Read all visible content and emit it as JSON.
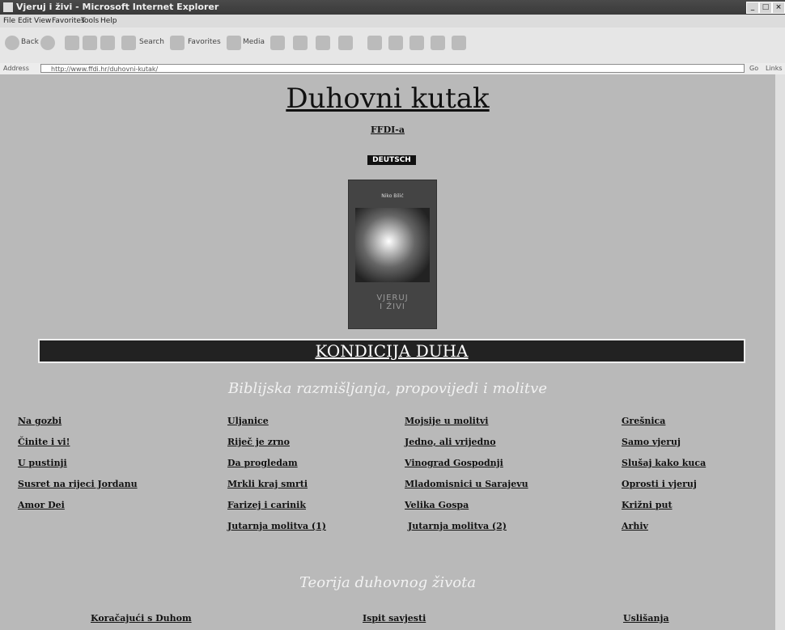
{
  "window": {
    "title": "Vjeruj i živi - Microsoft Internet Explorer"
  },
  "menu": [
    "File",
    "Edit",
    "View",
    "Favorites",
    "Tools",
    "Help"
  ],
  "toolbar": {
    "back": "Back",
    "search": "Search",
    "favorites": "Favorites",
    "media": "Media"
  },
  "address": {
    "label": "Address",
    "url": "http://www.ffdi.hr/duhovni-kutak/",
    "go": "Go",
    "links": "Links"
  },
  "page": {
    "title": "Duhovni kutak",
    "ffdi_link": "FFDI-a",
    "deutsch": "DEUTSCH",
    "book": {
      "author": "Niko Bilić",
      "title_line1": "VJERUJ",
      "title_line2": "I ŽIVI"
    },
    "banner": "KONDICIJA DUHA",
    "subtitle1": "Biblijska razmišljanja, propovijedi i molitve",
    "links_col1": [
      "Na gozbi",
      "Činite i vi!",
      "U pustinji",
      "Susret na rijeci Jordanu",
      "Amor Dei"
    ],
    "links_col2": [
      "Uljanice",
      "Riječ je zrno",
      "Da progledam",
      "Mrkli kraj smrti",
      "Farizej i carinik",
      "Jutarnja molitva (1)"
    ],
    "links_col3": [
      "Mojsije u molitvi",
      "Jedno, ali vrijedno",
      "Vinograd Gospodnji",
      "Mladomisnici u Sarajevu",
      "Velika Gospa",
      "Jutarnja molitva (2)"
    ],
    "links_col4": [
      "Grešnica",
      "Samo vjeruj",
      "Slušaj kako kuca",
      "Oprosti i vjeruj",
      "Križni put",
      "Arhiv"
    ],
    "subtitle2": "Teorija duhovnog života",
    "links_bottom": [
      "Koračajući s Duhom",
      "Ispit savjesti",
      "Uslišanja"
    ]
  }
}
